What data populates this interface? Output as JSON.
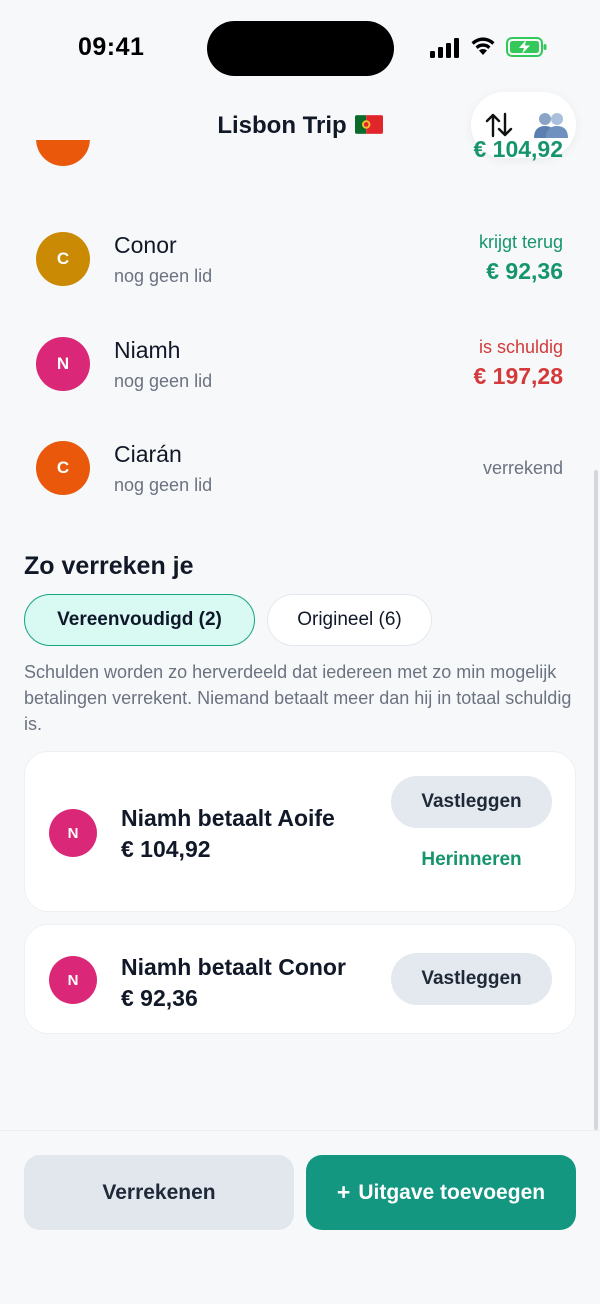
{
  "status_bar": {
    "time": "09:41"
  },
  "header": {
    "title": "Lisbon Trip",
    "sort_icon": "arrows-up-down-icon",
    "people_icon": "people-icon"
  },
  "members": [
    {
      "initial": "",
      "name": "",
      "sub": "",
      "status": "",
      "amount": "€ 104,92",
      "avatar_color": "#ea580c",
      "tone": "green",
      "partial": true
    },
    {
      "initial": "C",
      "name": "Conor",
      "sub": "nog geen lid",
      "status": "krijgt terug",
      "amount": "€ 92,36",
      "avatar_color": "#ca8a04",
      "tone": "green"
    },
    {
      "initial": "N",
      "name": "Niamh",
      "sub": "nog geen lid",
      "status": "is schuldig",
      "amount": "€ 197,28",
      "avatar_color": "#db2777",
      "tone": "red"
    },
    {
      "initial": "C",
      "name": "Ciarán",
      "sub": "nog geen lid",
      "status": "verrekend",
      "amount": "",
      "avatar_color": "#ea580c",
      "tone": "gray"
    }
  ],
  "settle": {
    "title": "Zo verreken je",
    "tab_simplified": "Vereenvoudigd (2)",
    "tab_original": "Origineel (6)",
    "explanation": "Schulden worden zo herverdeeld dat iedereen met zo min mogelijk betalingen verrekent. Niemand betaalt meer dan hij in totaal schuldig is.",
    "payments": [
      {
        "initial": "N",
        "title": "Niamh betaalt Aoife",
        "amount": "€ 104,92",
        "record_label": "Vastleggen",
        "remind_label": "Herinneren",
        "avatar_color": "#db2777"
      },
      {
        "initial": "N",
        "title": "Niamh betaalt Conor",
        "amount": "€ 92,36",
        "record_label": "Vastleggen",
        "avatar_color": "#db2777"
      }
    ]
  },
  "bottom": {
    "settle_label": "Verrekenen",
    "add_plus": "+",
    "add_label": "Uitgave toevoegen"
  },
  "colors": {
    "accent": "#139781",
    "positive": "#16956d",
    "negative": "#d43a3a"
  }
}
